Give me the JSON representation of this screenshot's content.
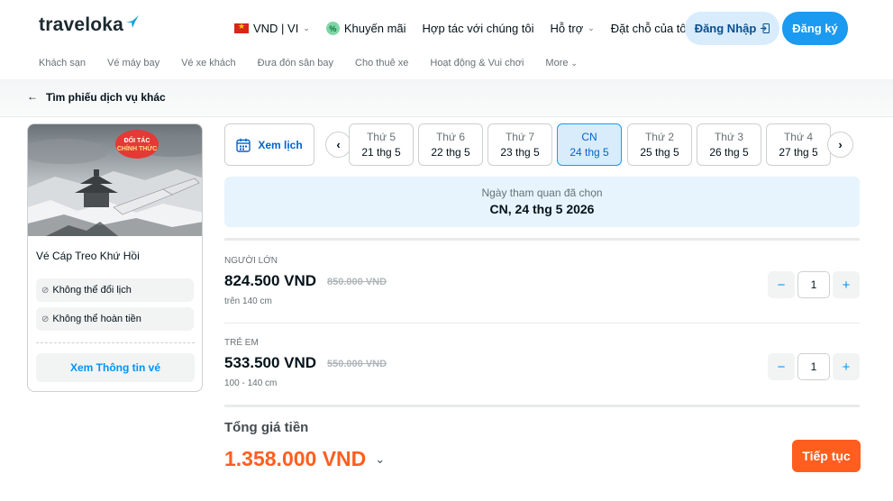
{
  "header": {
    "logo_text": "traveloka",
    "currency_lang": "VND | VI",
    "promotions": "Khuyến mãi",
    "partner": "Hợp tác với chúng tôi",
    "support": "Hỗ trợ",
    "bookings": "Đặt chỗ của tôi",
    "login": "Đăng Nhập",
    "register": "Đăng ký"
  },
  "subnav": {
    "items": [
      "Khách sạn",
      "Vé máy bay",
      "Vé xe khách",
      "Đưa đón sân bay",
      "Cho thuê xe",
      "Hoạt động & Vui chơi",
      "More"
    ]
  },
  "backbar": {
    "label": "Tìm phiếu dịch vụ khác"
  },
  "product": {
    "badge_line1": "ĐỐI TÁC",
    "badge_line2": "CHÍNH THỨC",
    "title": "Vé Cáp Treo Khứ Hồi",
    "policies": [
      "Không thể đổi lịch",
      "Không thể hoàn tiền"
    ],
    "info_button": "Xem Thông tin vé"
  },
  "calendar": {
    "view_button": "Xem lịch",
    "dates": [
      {
        "dow": "Thứ 5",
        "date": "21 thg 5"
      },
      {
        "dow": "Thứ 6",
        "date": "22 thg 5"
      },
      {
        "dow": "Thứ 7",
        "date": "23 thg 5"
      },
      {
        "dow": "CN",
        "date": "24 thg 5",
        "selected": true
      },
      {
        "dow": "Thứ 2",
        "date": "25 thg 5"
      },
      {
        "dow": "Thứ 3",
        "date": "26 thg 5"
      },
      {
        "dow": "Thứ 4",
        "date": "27 thg 5"
      }
    ],
    "selected_label": "Ngày tham quan đã chọn",
    "selected_value": "CN, 24 thg 5 2026"
  },
  "tickets": [
    {
      "type": "NGƯỜI LỚN",
      "price": "824.500 VND",
      "original": "850.000 VND",
      "note": "trên 140 cm",
      "qty": "1"
    },
    {
      "type": "TRẺ EM",
      "price": "533.500 VND",
      "original": "550.000 VND",
      "note": "100 - 140 cm",
      "qty": "1"
    }
  ],
  "total": {
    "label": "Tổng giá tiền",
    "value": "1.358.000 VND",
    "continue": "Tiếp tục"
  },
  "colors": {
    "primary_blue": "#1a9af0",
    "accent_orange": "#ff5e1f",
    "selected_date_bg": "#d8ecfc"
  }
}
